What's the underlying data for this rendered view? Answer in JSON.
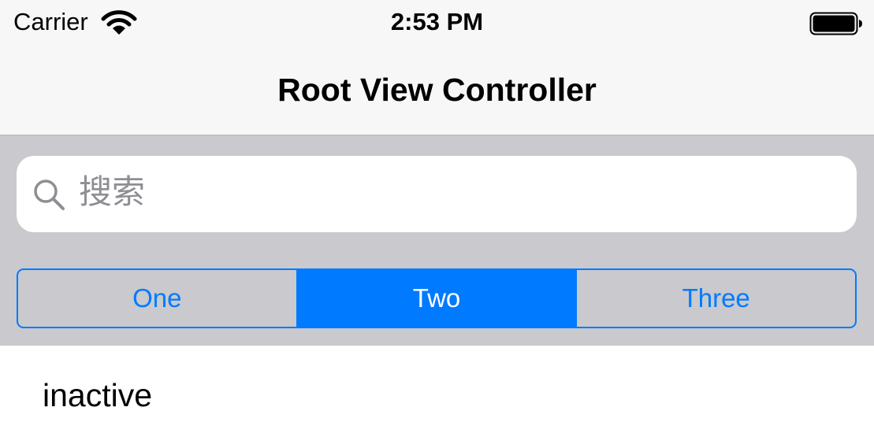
{
  "status_bar": {
    "carrier": "Carrier",
    "time": "2:53 PM",
    "wifi_icon": "wifi-icon",
    "battery_icon": "battery-icon",
    "battery_level": 1.0
  },
  "nav_bar": {
    "title": "Root View Controller"
  },
  "search": {
    "placeholder": "搜索",
    "icon": "search-icon"
  },
  "segmented_control": {
    "segments": [
      "One",
      "Two",
      "Three"
    ],
    "selected": "Two"
  },
  "content": {
    "row_label": "inactive"
  },
  "colors": {
    "accent": "#007aff",
    "bar_background": "#f7f7f7",
    "header_background": "#c9c9ce",
    "placeholder_text": "#8e8e93"
  }
}
